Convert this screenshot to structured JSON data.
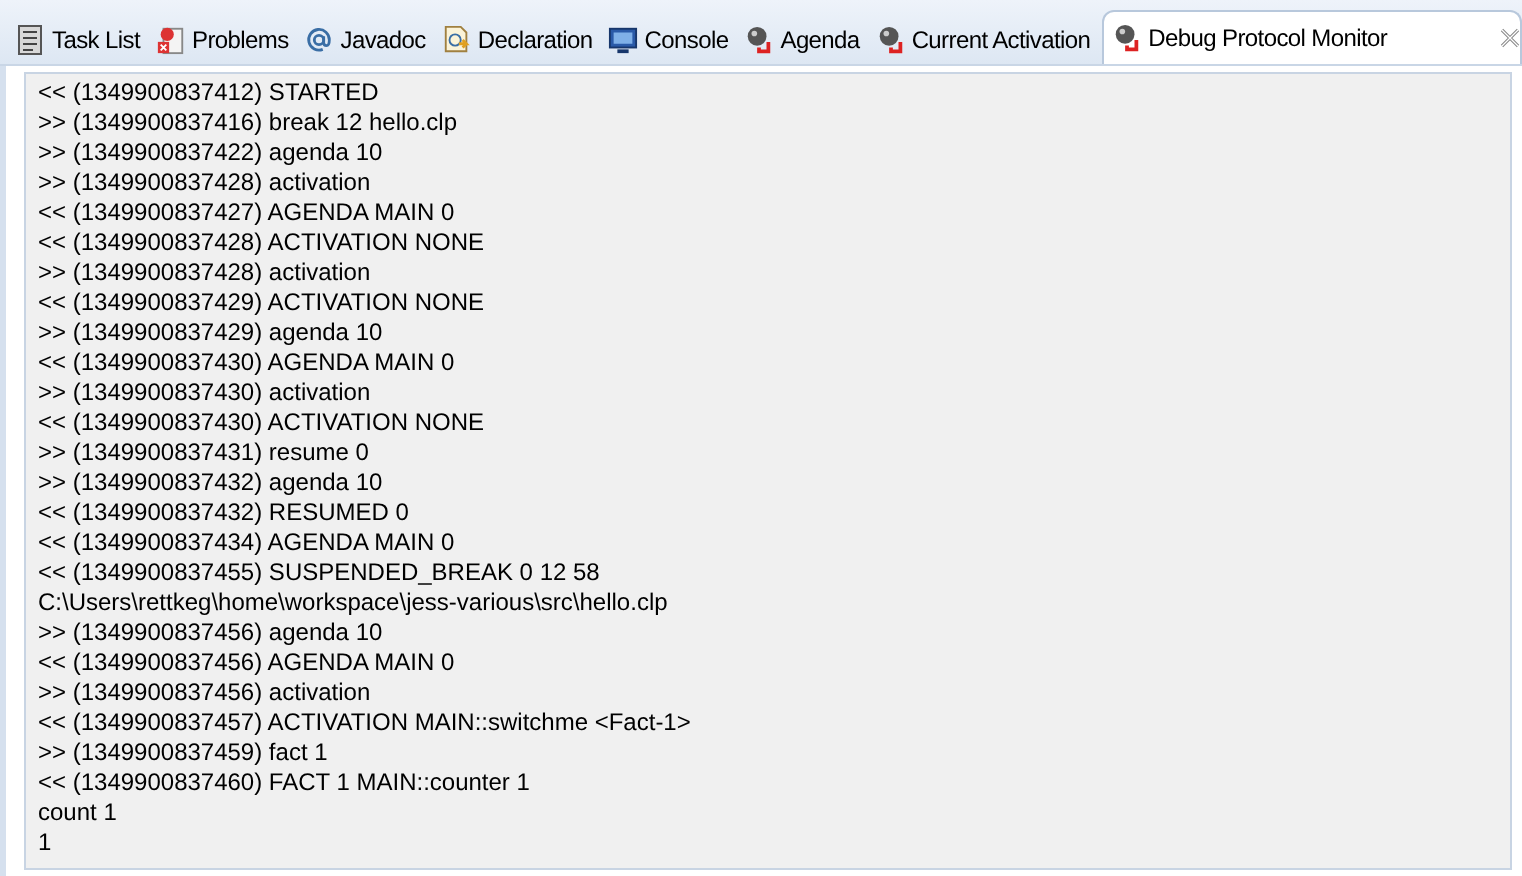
{
  "tabs": [
    {
      "label": "Task List",
      "kind": "tasklist",
      "selected": false
    },
    {
      "label": "Problems",
      "kind": "problems",
      "selected": false
    },
    {
      "label": "Javadoc",
      "kind": "javadoc",
      "selected": false
    },
    {
      "label": "Declaration",
      "kind": "declaration",
      "selected": false
    },
    {
      "label": "Console",
      "kind": "console",
      "selected": false
    },
    {
      "label": "Agenda",
      "kind": "debugger",
      "selected": false
    },
    {
      "label": "Current Activation",
      "kind": "debugger",
      "selected": false
    },
    {
      "label": "Debug Protocol Monitor",
      "kind": "debugger",
      "selected": true,
      "closable": true
    }
  ],
  "log_lines": [
    "<< (1349900837412) STARTED",
    ">> (1349900837416) break 12 hello.clp",
    ">> (1349900837422) agenda 10",
    ">> (1349900837428) activation",
    "<< (1349900837427) AGENDA MAIN 0",
    "<< (1349900837428) ACTIVATION NONE",
    ">> (1349900837428) activation",
    "<< (1349900837429) ACTIVATION NONE",
    ">> (1349900837429) agenda 10",
    "<< (1349900837430) AGENDA MAIN 0",
    ">> (1349900837430) activation",
    "<< (1349900837430) ACTIVATION NONE",
    ">> (1349900837431) resume 0",
    ">> (1349900837432) agenda 10",
    "<< (1349900837432) RESUMED 0",
    "<< (1349900837434) AGENDA MAIN 0",
    "<< (1349900837455) SUSPENDED_BREAK 0 12 58",
    "C:\\Users\\rettkeg\\home\\workspace\\jess-various\\src\\hello.clp",
    ">> (1349900837456) agenda 10",
    "<< (1349900837456) AGENDA MAIN 0",
    ">> (1349900837456) activation",
    "<< (1349900837457) ACTIVATION MAIN::switchme <Fact-1>",
    ">> (1349900837459) fact 1",
    "<< (1349900837460) FACT 1 MAIN::counter 1",
    "count 1",
    "1"
  ]
}
